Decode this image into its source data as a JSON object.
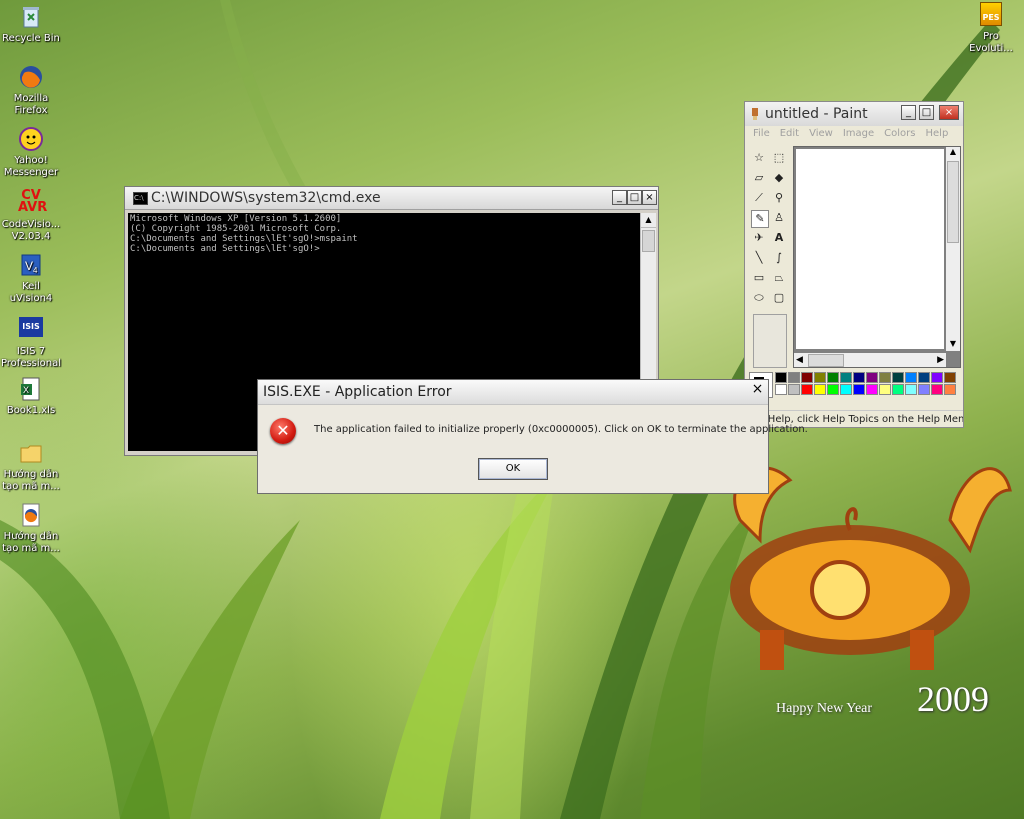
{
  "desktop": {
    "icons": [
      {
        "label": "Recycle Bin",
        "icon": "recycle-bin-icon"
      },
      {
        "label": "Mozilla Firefox",
        "icon": "firefox-icon"
      },
      {
        "label": "Yahoo! Messenger",
        "icon": "yahoo-messenger-icon"
      },
      {
        "label": "CodeVisio... V2.03.4",
        "icon": "codevision-icon",
        "badge": "CV AVR"
      },
      {
        "label": "Keil uVision4",
        "icon": "keil-icon"
      },
      {
        "label": "ISIS 7 Professional",
        "icon": "isis-icon",
        "badge": "ISIS"
      },
      {
        "label": "Book1.xls",
        "icon": "excel-file-icon"
      },
      {
        "label": "Hướng dẫn tạo mã m...",
        "icon": "folder-icon"
      },
      {
        "label": "Hướng dẫn tạo mã m...",
        "icon": "firefox-document-icon"
      },
      {
        "label": "Pro Evoluti...",
        "icon": "pes-game-icon",
        "badge": "PES"
      }
    ],
    "wallpaper_text": {
      "greeting": "Happy New Year",
      "year": "2009"
    }
  },
  "cmd": {
    "title": "C:\\WINDOWS\\system32\\cmd.exe",
    "lines": [
      "Microsoft Windows XP [Version 5.1.2600]",
      "(C) Copyright 1985-2001 Microsoft Corp.",
      "",
      "C:\\Documents and Settings\\lEt'sgO!>mspaint",
      "",
      "C:\\Documents and Settings\\lEt'sgO!>"
    ],
    "buttons": {
      "minimize": "_",
      "maximize": "□",
      "close": "×"
    }
  },
  "paint": {
    "title": "untitled - Paint",
    "menu": [
      "File",
      "Edit",
      "View",
      "Image",
      "Colors",
      "Help"
    ],
    "status": "For Help, click Help Topics on the Help Menu.",
    "palette_top": [
      "#000000",
      "#808080",
      "#800000",
      "#808000",
      "#008000",
      "#008080",
      "#000080",
      "#800080",
      "#808040",
      "#004040",
      "#0080ff",
      "#004080",
      "#8000ff",
      "#804000"
    ],
    "palette_bottom": [
      "#ffffff",
      "#c0c0c0",
      "#ff0000",
      "#ffff00",
      "#00ff00",
      "#00ffff",
      "#0000ff",
      "#ff00ff",
      "#ffff80",
      "#00ff80",
      "#80ffff",
      "#8080ff",
      "#ff0080",
      "#ff8040"
    ]
  },
  "error_dialog": {
    "title": "ISIS.EXE - Application Error",
    "message": "The application failed to initialize properly (0xc0000005). Click on OK to terminate the application.",
    "ok_label": "OK",
    "close_label": "×"
  }
}
